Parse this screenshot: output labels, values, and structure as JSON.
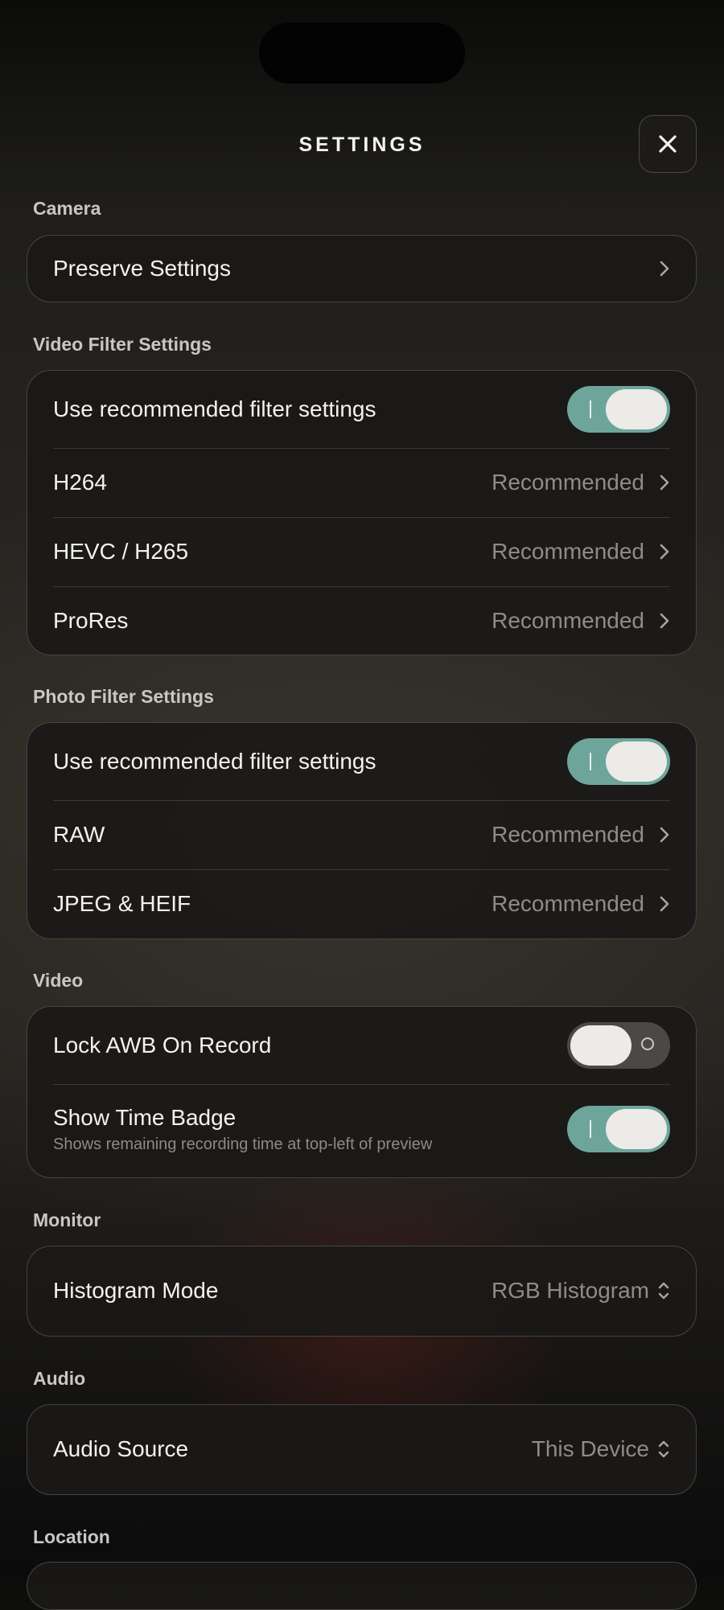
{
  "header": {
    "title": "SETTINGS"
  },
  "sections": {
    "camera": {
      "label": "Camera",
      "preserve_settings": "Preserve Settings"
    },
    "video_filter": {
      "label": "Video Filter Settings",
      "use_recommended": "Use recommended filter settings",
      "use_recommended_on": true,
      "h264_label": "H264",
      "h264_value": "Recommended",
      "hevc_label": "HEVC / H265",
      "hevc_value": "Recommended",
      "prores_label": "ProRes",
      "prores_value": "Recommended"
    },
    "photo_filter": {
      "label": "Photo Filter Settings",
      "use_recommended": "Use recommended filter settings",
      "use_recommended_on": true,
      "raw_label": "RAW",
      "raw_value": "Recommended",
      "jpeg_label": "JPEG & HEIF",
      "jpeg_value": "Recommended"
    },
    "video": {
      "label": "Video",
      "lock_awb": "Lock AWB On Record",
      "lock_awb_on": false,
      "time_badge": "Show Time Badge",
      "time_badge_sub": "Shows remaining recording time at top-left of preview",
      "time_badge_on": true
    },
    "monitor": {
      "label": "Monitor",
      "histogram_label": "Histogram Mode",
      "histogram_value": "RGB Histogram"
    },
    "audio": {
      "label": "Audio",
      "source_label": "Audio Source",
      "source_value": "This Device"
    },
    "location": {
      "label": "Location"
    }
  },
  "colors": {
    "toggle_on": "#6ea59b",
    "toggle_off": "#4a4946",
    "card_border": "#7d7a73"
  }
}
